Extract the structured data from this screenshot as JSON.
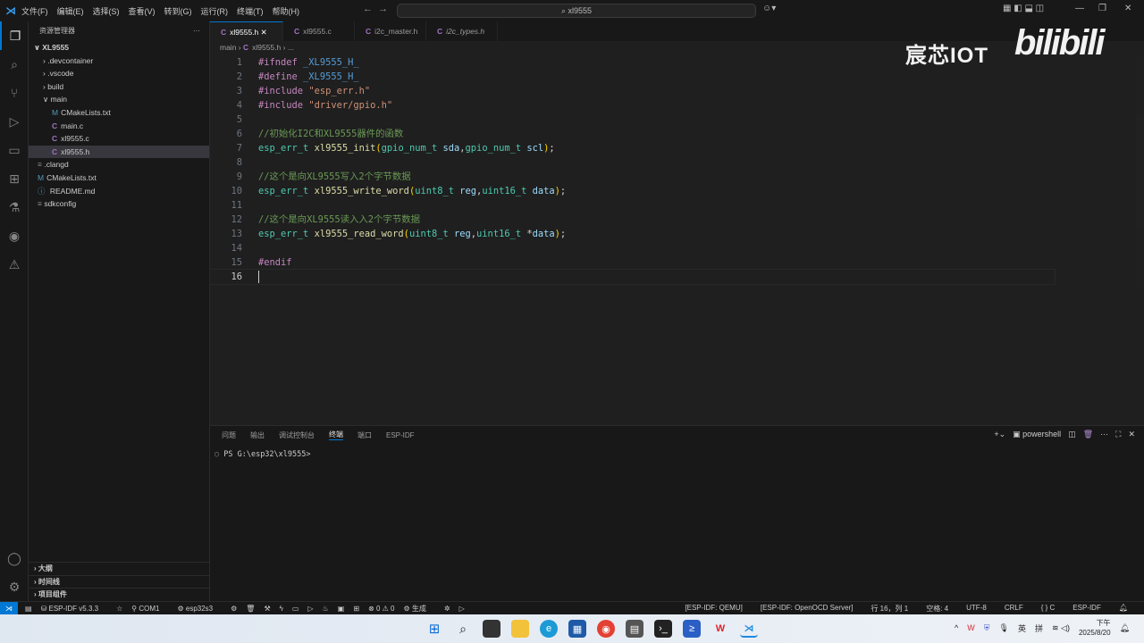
{
  "titlebar": {
    "menus": [
      "文件(F)",
      "编辑(E)",
      "选择(S)",
      "查看(V)",
      "转到(G)",
      "运行(R)",
      "终端(T)",
      "帮助(H)"
    ],
    "search": "xl9555"
  },
  "sidebar": {
    "title": "资源管理器",
    "root": "XL9555",
    "items": [
      {
        "label": ".devcontainer",
        "type": "folder",
        "indent": 1
      },
      {
        "label": ".vscode",
        "type": "folder",
        "indent": 1
      },
      {
        "label": "build",
        "type": "folder",
        "indent": 1
      },
      {
        "label": "main",
        "type": "folder-open",
        "indent": 1
      },
      {
        "label": "CMakeLists.txt",
        "type": "cmake",
        "indent": 2
      },
      {
        "label": "main.c",
        "type": "c",
        "indent": 2
      },
      {
        "label": "xl9555.c",
        "type": "c",
        "indent": 2
      },
      {
        "label": "xl9555.h",
        "type": "c",
        "indent": 2,
        "selected": true
      },
      {
        "label": ".clangd",
        "type": "file",
        "indent": 1
      },
      {
        "label": "CMakeLists.txt",
        "type": "cmake",
        "indent": 1
      },
      {
        "label": "README.md",
        "type": "md",
        "indent": 1
      },
      {
        "label": "sdkconfig",
        "type": "file",
        "indent": 1
      }
    ],
    "footer": [
      "大纲",
      "时间线",
      "项目组件"
    ]
  },
  "tabs": [
    {
      "label": "xl9555.h",
      "active": true
    },
    {
      "label": "xl9555.c"
    },
    {
      "label": "i2c_master.h"
    },
    {
      "label": "i2c_types.h"
    }
  ],
  "breadcrumb": [
    "main",
    "xl9555.h",
    "..."
  ],
  "editor": {
    "cursor_line": 16,
    "lines": [
      [
        [
          "#ifndef ",
          "kw"
        ],
        [
          "_XL9555_H_",
          "mac"
        ]
      ],
      [
        [
          "#define ",
          "kw"
        ],
        [
          "_XL9555_H_",
          "mac"
        ]
      ],
      [
        [
          "#include ",
          "kw"
        ],
        [
          "\"esp_err.h\"",
          "str"
        ]
      ],
      [
        [
          "#include ",
          "kw"
        ],
        [
          "\"driver/gpio.h\"",
          "str"
        ]
      ],
      [],
      [
        [
          "//初始化I2C和XL9555器件的函数",
          "cm"
        ]
      ],
      [
        [
          "esp_err_t",
          "ty"
        ],
        [
          " "
        ],
        [
          "xl9555_init",
          "fn"
        ],
        [
          "(",
          "par"
        ],
        [
          "gpio_num_t",
          "ty"
        ],
        [
          " "
        ],
        [
          "sda",
          "id"
        ],
        [
          ","
        ],
        [
          "gpio_num_t",
          "ty"
        ],
        [
          " "
        ],
        [
          "scl",
          "id"
        ],
        [
          ")",
          "par"
        ],
        [
          ";"
        ]
      ],
      [],
      [
        [
          "//这个是向XL9555写入2个字节数据",
          "cm"
        ]
      ],
      [
        [
          "esp_err_t",
          "ty"
        ],
        [
          " "
        ],
        [
          "xl9555_write_word",
          "fn"
        ],
        [
          "(",
          "par"
        ],
        [
          "uint8_t",
          "ty"
        ],
        [
          " "
        ],
        [
          "reg",
          "id"
        ],
        [
          ","
        ],
        [
          "uint16_t",
          "ty"
        ],
        [
          " "
        ],
        [
          "data",
          "id"
        ],
        [
          ")",
          "par"
        ],
        [
          ";"
        ]
      ],
      [],
      [
        [
          "//这个是向XL9555读入入2个字节数据",
          "cm"
        ]
      ],
      [
        [
          "esp_err_t",
          "ty"
        ],
        [
          " "
        ],
        [
          "xl9555_read_word",
          "fn"
        ],
        [
          "(",
          "par"
        ],
        [
          "uint8_t",
          "ty"
        ],
        [
          " "
        ],
        [
          "reg",
          "id"
        ],
        [
          ","
        ],
        [
          "uint16_t",
          "ty"
        ],
        [
          " *"
        ],
        [
          "data",
          "id"
        ],
        [
          ")",
          "par"
        ],
        [
          ";"
        ]
      ],
      [],
      [
        [
          "#endif",
          "kw"
        ]
      ],
      []
    ]
  },
  "watermark": {
    "text": "宸芯IOT",
    "logo": "bilibili"
  },
  "panel": {
    "tabs": [
      "问题",
      "输出",
      "调试控制台",
      "终端",
      "端口",
      "ESP-IDF"
    ],
    "active": "终端",
    "shell": "powershell",
    "prompt": "PS G:\\esp32\\xl9555>"
  },
  "status": {
    "left": [
      "ESP-IDF v5.3.3",
      "COM1",
      "esp32s3",
      "⊗ 0 ⚠ 0",
      "生成"
    ],
    "right": [
      "[ESP-IDF: QEMU]",
      "[ESP-IDF: OpenOCD Server]",
      "行 16，列 1",
      "空格: 4",
      "UTF-8",
      "CRLF",
      "{ } C",
      "ESP-IDF"
    ]
  },
  "taskbar": {
    "tray": [
      "英",
      "拼"
    ],
    "time": "下午",
    "date": "2025/8/20"
  },
  "colors": {
    "kw": "#c586c0",
    "mac": "#569cd6",
    "str": "#ce9178",
    "cm": "#6a9955",
    "ty": "#4ec9b0",
    "fn": "#dcdcaa",
    "id": "#9cdcfe",
    "par": "#ffd700",
    "accent": "#0078d4"
  }
}
